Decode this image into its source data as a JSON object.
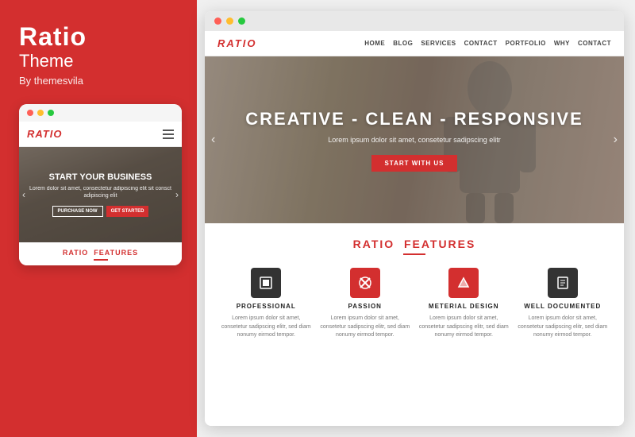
{
  "leftPanel": {
    "title": "Ratio",
    "subtitle": "Theme",
    "by": "By themesvila"
  },
  "mobilePreview": {
    "logo": "RATIO",
    "hero": {
      "title": "START YOUR BUSINESS",
      "description": "Lorem dolor sit amet, consectetur adipiscing elit sit consct adipiscing elit",
      "buttons": [
        {
          "label": "PURCHASE NOW",
          "style": "outline"
        },
        {
          "label": "GET STARTED",
          "style": "red"
        }
      ]
    },
    "featuresBar": {
      "prefix": "RATIO",
      "suffix": "FEATURES"
    }
  },
  "sitePreview": {
    "nav": {
      "logo": "RATIO",
      "links": [
        "HOME",
        "BLOG",
        "SERVICES",
        "CONTACT",
        "PORTFOLIO",
        "WHY",
        "CONTACT"
      ]
    },
    "hero": {
      "title": "CREATIVE - CLEAN - RESPONSIVE",
      "description": "Lorem ipsum dolor sit amet, consetetur sadipscing elitr",
      "buttonLabel": "START WITH US"
    },
    "featuresSection": {
      "heading_prefix": "RATIO",
      "heading_suffix": "FEATURES",
      "features": [
        {
          "icon": "▣",
          "title": "PROFESSIONAL",
          "description": "Lorem ipsum dolor sit amet, consetetur sadipscing elitr, sed diam nonumy eirmod tempor.",
          "iconBg": "#333"
        },
        {
          "icon": "✖",
          "title": "PASSION",
          "description": "Lorem ipsum dolor sit amet, consetetur sadipscing elitr, sed diam nonumy eirmod tempor.",
          "iconBg": "#d32f2f"
        },
        {
          "icon": "▶",
          "title": "METERIAL DESIGN",
          "description": "Lorem ipsum dolor sit amet, consetetur sadipscing elitr, sed diam nonumy eirmod tempor.",
          "iconBg": "#d32f2f"
        },
        {
          "icon": "📄",
          "title": "WELL DOCUMENTED",
          "description": "Lorem ipsum dolor sit amet, consetetur sadipscing elitr, sed diam nonumy eirmod tempor.",
          "iconBg": "#333"
        }
      ]
    }
  }
}
